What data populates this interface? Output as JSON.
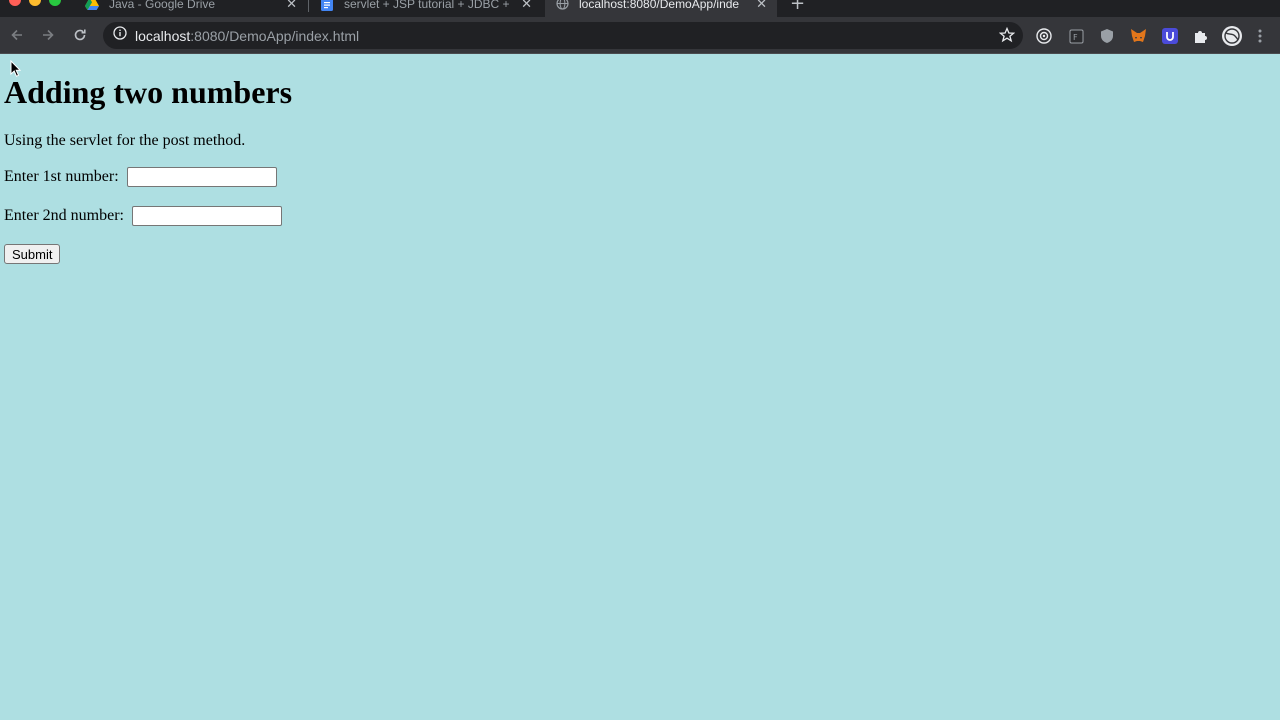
{
  "browser": {
    "tabs": [
      {
        "title": "Java - Google Drive",
        "icon": "google-drive-icon"
      },
      {
        "title": "servlet + JSP tutorial + JDBC + ...",
        "icon": "google-docs-icon"
      },
      {
        "title": "localhost:8080/DemoApp/inde",
        "icon": "globe-icon",
        "active": true
      }
    ],
    "url_host": "localhost",
    "url_path": ":8080/DemoApp/index.html"
  },
  "page": {
    "heading": "Adding two numbers",
    "description": "Using the servlet for the post method.",
    "field1_label": "Enter 1st number: ",
    "field1_value": "",
    "field2_label": "Enter 2nd number: ",
    "field2_value": "",
    "submit_label": "Submit"
  },
  "colors": {
    "page_background": "#aedfe2",
    "chrome_dark": "#202124",
    "toolbar": "#35363a"
  }
}
